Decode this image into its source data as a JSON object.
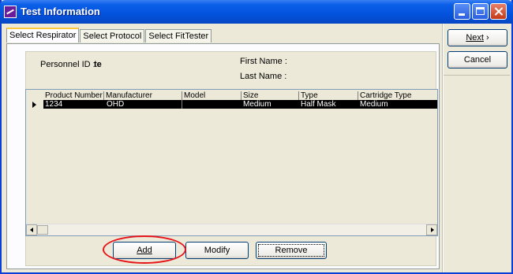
{
  "window": {
    "title": "Test Information"
  },
  "tabs": [
    "Select Respirator",
    "Select Protocol",
    "Select FitTester"
  ],
  "personnel": {
    "id_label": "Personnel ID :",
    "id_value": "te",
    "first_name_label": "First Name :",
    "last_name_label": "Last Name :"
  },
  "grid": {
    "columns": [
      "Product Number",
      "Manufacturer",
      "Model",
      "Size",
      "Type",
      "Cartridge Type"
    ],
    "rows": [
      [
        "1234",
        "OHD",
        "",
        "Medium",
        "Half Mask",
        "Medium"
      ]
    ]
  },
  "buttons": {
    "add": "Add",
    "modify": "Modify",
    "remove": "Remove",
    "next": "Next",
    "next_arrow": "›",
    "cancel": "Cancel"
  },
  "colors": {
    "titlebar": "#0453dd",
    "annotation": "#e8141a",
    "selection": "#000000"
  }
}
